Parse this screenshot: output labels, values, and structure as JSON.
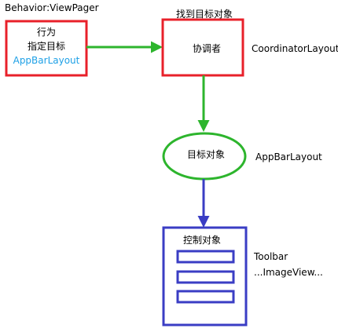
{
  "nodes": {
    "behavior_title": "Behavior:ViewPager",
    "behavior_line1": "行为",
    "behavior_line2": "指定目标",
    "behavior_target": "AppBarLayout",
    "coordinator_title": "找到目标对象",
    "coordinator_label": "协调者",
    "coordinator_side": "CoordinatorLayout",
    "target_label": "目标对象",
    "target_side": "AppBarLayout",
    "controlled_label": "控制对象",
    "controlled_side_1": "Toolbar",
    "controlled_side_2": "...ImageView..."
  },
  "colors": {
    "red": "#e8202a",
    "green": "#2db52d",
    "blue": "#3a3dc4",
    "cyan_text": "#1ea0e6"
  }
}
